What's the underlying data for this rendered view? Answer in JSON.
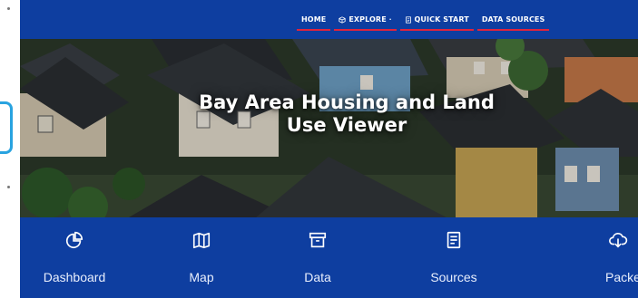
{
  "nav": {
    "items": [
      {
        "label": "HOME",
        "icon": ""
      },
      {
        "label": "EXPLORE",
        "icon": "cube-icon",
        "dropdown": true
      },
      {
        "label": "QUICK START",
        "icon": "document-icon"
      },
      {
        "label": "DATA SOURCES",
        "icon": ""
      }
    ]
  },
  "hero": {
    "title_line1": "Bay Area Housing and Land",
    "title_line2": "Use Viewer"
  },
  "tiles": [
    {
      "label": "Dashboard",
      "icon": "pie-chart-icon"
    },
    {
      "label": "Map",
      "icon": "map-icon"
    },
    {
      "label": "Data",
      "icon": "archive-box-icon"
    },
    {
      "label": "Sources",
      "icon": "document-list-icon"
    },
    {
      "label": "Packet",
      "icon": "cloud-download-icon"
    }
  ],
  "colors": {
    "brand_blue": "#0e3ea0",
    "nav_underline": "#e0243c",
    "accent_left": "#29a3e0"
  }
}
